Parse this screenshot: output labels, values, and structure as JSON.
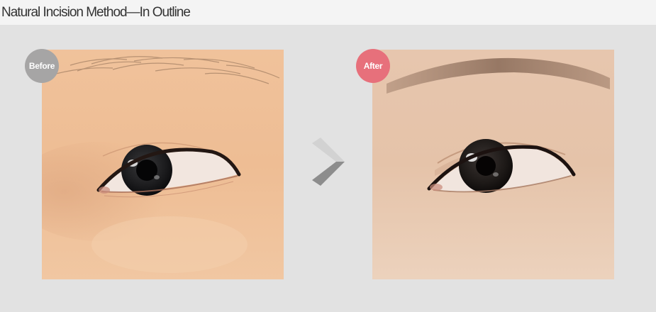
{
  "header": {
    "title": "Natural Incision Method—In Outline"
  },
  "comparison": {
    "before": {
      "label": "Before",
      "badge_color": "#a6a5a5"
    },
    "after": {
      "label": "After",
      "badge_color": "#e7707b"
    }
  },
  "icons": {
    "next": "chevron-right-icon"
  }
}
